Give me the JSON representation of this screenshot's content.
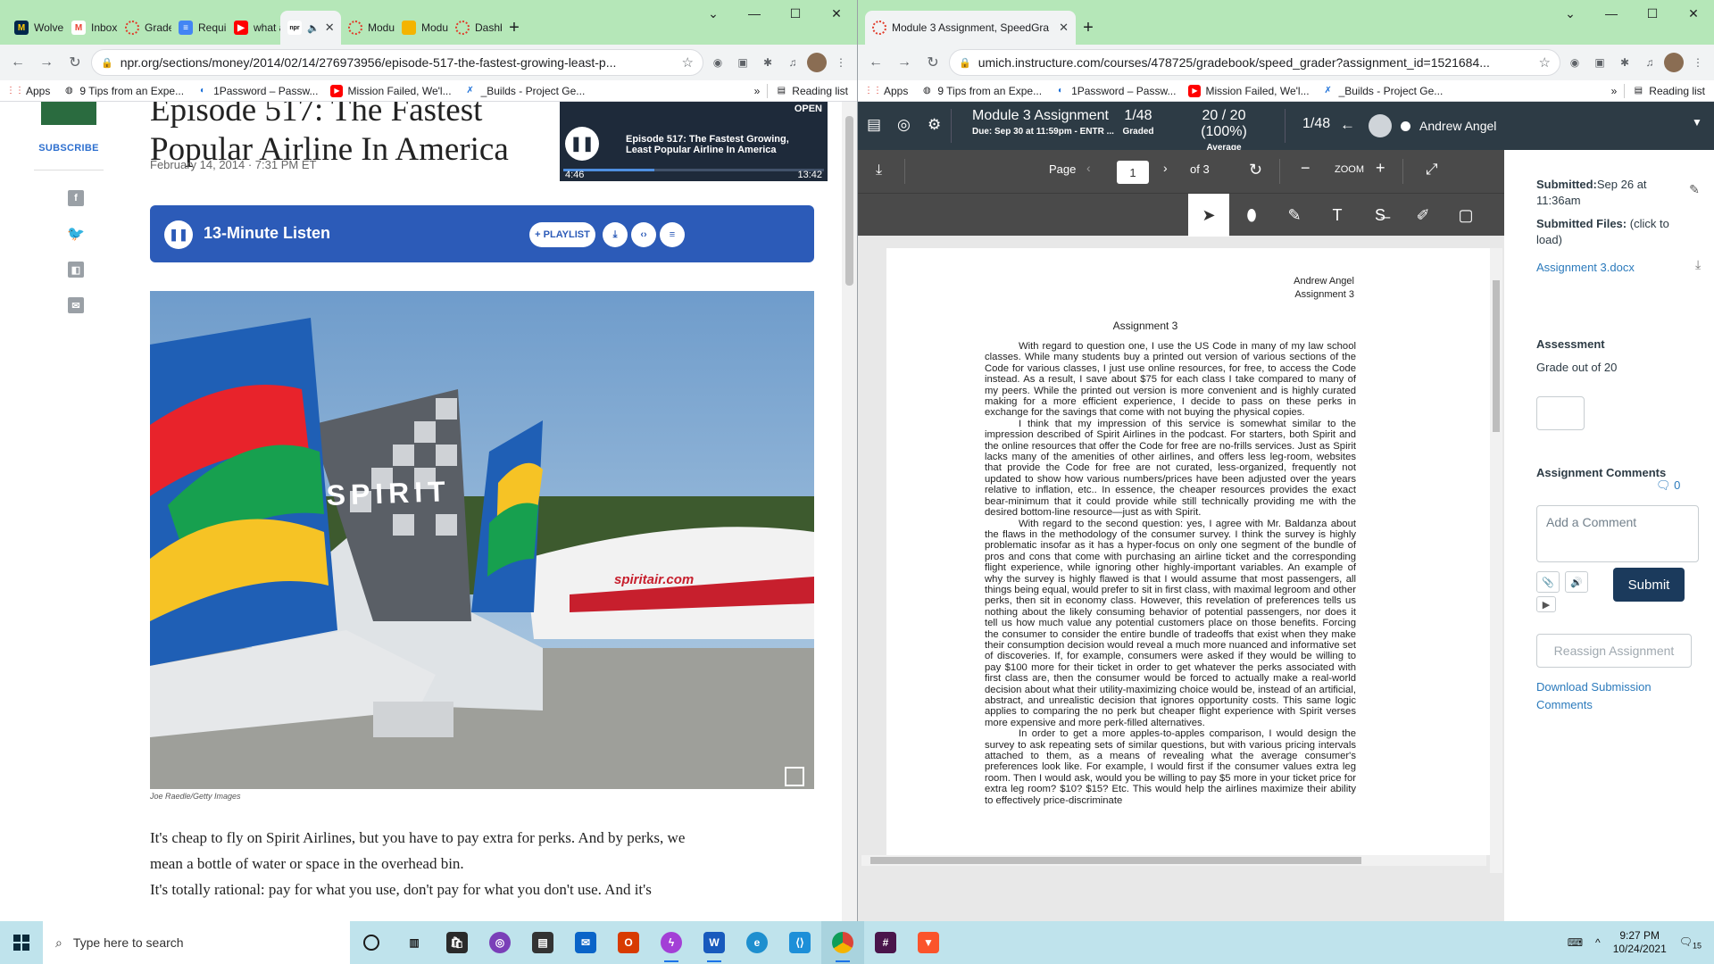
{
  "left_browser": {
    "tabs": [
      {
        "label": "Wolve",
        "icon": "michigan-m-icon",
        "color": "#00274c"
      },
      {
        "label": "Inbox",
        "icon": "gmail-icon",
        "color": "#ea4335"
      },
      {
        "label": "Grade",
        "icon": "canvas-icon",
        "color": "#e13b2a"
      },
      {
        "label": "Requir",
        "icon": "docs-icon",
        "color": "#4285f4"
      },
      {
        "label": "what a",
        "icon": "youtube-icon",
        "color": "#ff0000"
      },
      {
        "label": "",
        "icon": "npr-icon",
        "color": "#111111",
        "active": true,
        "audio": true
      },
      {
        "label": "Modu",
        "icon": "canvas-icon",
        "color": "#e13b2a"
      },
      {
        "label": "Modu",
        "icon": "slides-icon",
        "color": "#f4b400"
      },
      {
        "label": "Dashb",
        "icon": "canvas-icon",
        "color": "#e13b2a"
      }
    ],
    "url": "npr.org/sections/money/2014/02/14/276973956/episode-517-the-fastest-growing-least-p...",
    "bookmarks": [
      {
        "label": "Apps",
        "icon": "apps-grid-icon"
      },
      {
        "label": "9 Tips from an Expe...",
        "icon": "globe-icon"
      },
      {
        "label": "1Password – Passw...",
        "icon": "onepassword-icon"
      },
      {
        "label": "Mission Failed, We'l...",
        "icon": "youtube-icon"
      },
      {
        "label": "_Builds - Project Ge...",
        "icon": "bug-icon"
      }
    ],
    "reading_list": "Reading list"
  },
  "npr": {
    "subscribe": "SUBSCRIBE",
    "title_line1": "Episode 517: The Fastest",
    "title_line2": "Popular Airline In America",
    "date": "February 14, 2014 · 7:31 PM ET",
    "mini_player": {
      "open": "OPEN",
      "title": "Episode 517: The Fastest Growing, Least Popular Airline In America",
      "elapsed": "4:46",
      "duration": "13:42",
      "progress_fraction": 0.348
    },
    "player": {
      "label": "13-Minute Listen",
      "playlist": "+ PLAYLIST"
    },
    "photo_caption": "Joe Raedle/Getty Images",
    "tail_text": "SPIRIT",
    "fuselage_text": "spiritair.com",
    "paragraphs": [
      "It's cheap to fly on Spirit Airlines, but you have to pay extra for perks. And by perks, we mean a bottle of water or space in the overhead bin.",
      "It's totally rational: pay for what you use, don't pay for what you don't use. And it's"
    ]
  },
  "right_browser": {
    "tab_title": "Module 3 Assignment, SpeedGra",
    "url": "umich.instructure.com/courses/478725/gradebook/speed_grader?assignment_id=1521684...",
    "bookmarks": [
      {
        "label": "Apps"
      },
      {
        "label": "9 Tips from an Expe..."
      },
      {
        "label": "1Password – Passw..."
      },
      {
        "label": "Mission Failed, We'l..."
      },
      {
        "label": "_Builds - Project Ge..."
      }
    ],
    "reading_list": "Reading list"
  },
  "speedgrader": {
    "assignment": "Module 3 Assignment",
    "due": "Due: Sep 30 at 11:59pm - ENTR ...",
    "graded_count": "1/48",
    "graded_label": "Graded",
    "average_value": "20 / 20 (100%)",
    "average_label": "Average",
    "student_index": "1/48",
    "student_name": "Andrew Angel",
    "viewer": {
      "page_label": "Page",
      "page_value": "1",
      "page_of": "of 3",
      "zoom_label": "ZOOM"
    },
    "doc": {
      "author_line1": "Andrew Angel",
      "author_line2": "Assignment 3",
      "title": "Assignment 3",
      "paragraphs": [
        "With regard to question one, I use the US Code in many of my law school classes. While many students buy a printed out version of various sections of the Code for various classes, I just use online resources, for free, to access the Code instead. As a result, I save about $75 for each class I take compared to many of my peers. While the printed out version is more convenient and is highly curated making for a more efficient experience, I decide to pass on these perks in exchange for the savings that come with not buying the physical copies.",
        "I think that my impression of this service is somewhat similar to the impression described of Spirit Airlines in the podcast. For starters, both Spirit and the online resources that offer the Code for free are no-frills services. Just as Spirit lacks many of the amenities of other airlines, and offers less leg-room, websites that provide the Code for free are not curated, less-organized, frequently not updated to show how various numbers/prices have been adjusted over the years relative to inflation, etc.. In essence, the cheaper resources provides the exact bear-minimum that it could provide while still technically providing me with the desired bottom-line resource—just as with Spirit.",
        "With regard to the second question: yes, I agree with Mr. Baldanza about the flaws in the methodology of the consumer survey. I think the survey is highly problematic insofar as it has a hyper-focus on only one segment of the bundle of pros and cons that come with purchasing an airline ticket and the corresponding flight experience, while ignoring other highly-important variables. An example of why the survey is highly flawed is that I would assume that most passengers, all things being equal, would prefer to sit in first class, with maximal legroom and other perks, then sit in economy class. However, this revelation of preferences tells us nothing about the likely consuming behavior of potential passengers, nor does it tell us how much value any potential customers place on those benefits. Forcing the consumer to consider the entire bundle of tradeoffs that exist when they make their consumption decision would reveal a much more nuanced and informative set of discoveries. If, for example, consumers were asked if they would be willing to pay $100 more for their ticket in order to get whatever the perks associated with first class are, then the consumer would be forced to actually make a real-world decision about what their utility-maximizing choice would be, instead of an artificial, abstract, and unrealistic decision that ignores opportunity costs. This same logic applies to comparing the no perk but cheaper flight experience with Spirit verses more expensive and more perk-filled alternatives.",
        "In order to get a more apples-to-apples comparison, I would design the survey to ask repeating sets of similar questions, but with various pricing intervals attached to them, as a means of revealing what the average consumer's preferences look like. For example, I would first if the consumer values extra leg room. Then I would ask, would you be willing to pay $5 more in your ticket price for extra leg room? $10? $15? Etc. This would help the airlines maximize their ability to effectively price-discriminate"
      ]
    },
    "panel": {
      "submitted_label": "Submitted:",
      "submitted_value": "Sep 26 at 11:36am",
      "files_label": "Submitted Files:",
      "files_hint": "(click to load)",
      "file_name": "Assignment 3.docx",
      "assessment_label": "Assessment",
      "grade_out_of": "Grade out of 20",
      "comments_label": "Assignment Comments",
      "comments_count": "0",
      "comment_placeholder": "Add a Comment",
      "submit": "Submit",
      "reassign": "Reassign Assignment",
      "download_comments": "Download Submission Comments"
    }
  },
  "taskbar": {
    "search_placeholder": "Type here to search",
    "apps": [
      {
        "icon": "cortana-icon",
        "color": "#1a1a1a"
      },
      {
        "icon": "task-view-icon",
        "color": "#1a1a1a"
      },
      {
        "icon": "store-icon",
        "color": "#2a2a2a"
      },
      {
        "icon": "podcast-icon",
        "color": "#7a3fb8"
      },
      {
        "icon": "files-icon",
        "color": "#333333"
      },
      {
        "icon": "mail-icon",
        "color": "#0a64c8"
      },
      {
        "icon": "office-icon",
        "color": "#d83b01"
      },
      {
        "icon": "messenger-icon",
        "color": "#a33fd6"
      },
      {
        "icon": "word-icon",
        "color": "#185abd"
      },
      {
        "icon": "edge-icon",
        "color": "#1e8fcf"
      },
      {
        "icon": "vscode-icon",
        "color": "#1d8fd8"
      },
      {
        "icon": "chrome-icon",
        "color": "#2e9c4a"
      },
      {
        "icon": "slack-icon",
        "color": "#4a154b"
      },
      {
        "icon": "brave-icon",
        "color": "#fb542b"
      }
    ],
    "time": "9:27 PM",
    "date": "10/24/2021",
    "notifications": "15"
  }
}
